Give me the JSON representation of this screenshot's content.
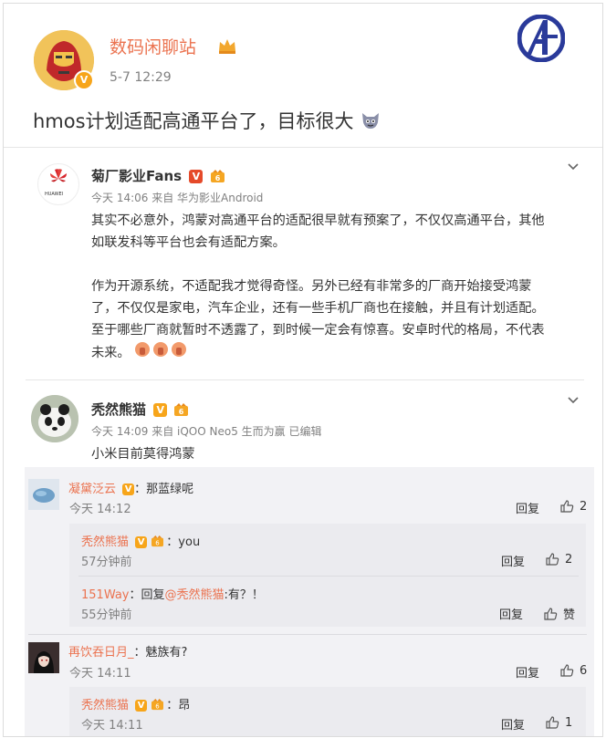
{
  "post": {
    "author": "数码闲聊站",
    "time": "5-7 12:29",
    "text": "hmos计划适配高通平台了，目标很大",
    "author_badge": "crown-icon",
    "corner_logo": "avengers-logo"
  },
  "comments": [
    {
      "author": "菊厂影业Fans",
      "meta": "今天 14:06 来自 华为影业Android",
      "avatar_text": "HUAWEI",
      "paragraphs": [
        "其实不必意外，鸿蒙对高通平台的适配很早就有预案了，不仅仅高通平台，其他",
        "如联发科等平台也会有适配方案。",
        "",
        "作为开源系统，不适配我才觉得奇怪。另外已经有非常多的厂商开始接受鸿蒙",
        "了，不仅仅是家电，汽车企业，还有一些手机厂商也在接触，并且有计划适配。",
        "至于哪些厂商就暂时不透露了，到时候一定会有惊喜。安卓时代的格局，不代表",
        "未来。"
      ]
    },
    {
      "author": "秃然熊猫",
      "meta": "今天 14:09 来自 iQOO Neo5 生而为赢  已编辑",
      "text": "小米目前莫得鸿蒙"
    }
  ],
  "replies": [
    {
      "author": "凝黛泛云",
      "text": "：那蓝绿呢",
      "time": "今天 14:12",
      "reply": "回复",
      "likes": "2"
    },
    {
      "author": "秃然熊猫",
      "text": "：you",
      "time": "57分钟前",
      "reply": "回复",
      "likes": "2"
    },
    {
      "author": "151Way",
      "text_prefix": "：回复",
      "mention": "@秃然熊猫",
      "text_suffix": ":有？！",
      "time": "55分钟前",
      "reply": "回复",
      "likes": "赞"
    },
    {
      "author": "再饮吞日月_",
      "text": "：魅族有?",
      "time": "今天 14:11",
      "reply": "回复",
      "likes": "6"
    },
    {
      "author": "秃然熊猫",
      "text": "：昂",
      "time": "今天 14:11",
      "reply": "回复",
      "likes": "1"
    }
  ],
  "colors": {
    "name": "#eb7350",
    "meta": "#808080",
    "subbg": "#f2f2f5",
    "badge": "#f7a51a"
  }
}
